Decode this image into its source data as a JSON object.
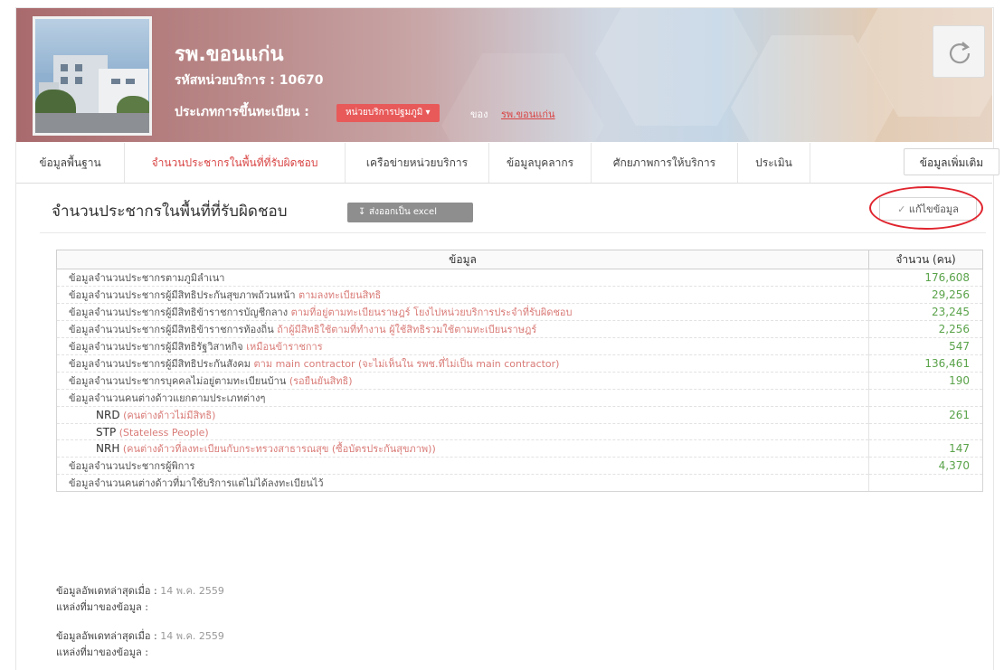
{
  "header": {
    "hospital_name": "รพ.ขอนแก่น",
    "service_code": "รหัสหน่วยบริการ : 10670",
    "registration_type_label": "ประเภทการขึ้นทะเบียน :",
    "registration_type_value": "หน่วยบริการปฐมภูมิ",
    "of_label": "ของ",
    "parent_link": "รพ.ขอนแก่น"
  },
  "tabs": [
    "ข้อมูลพื้นฐาน",
    "จำนวนประชากรในพื้นที่ที่รับผิดชอบ",
    "เครือข่ายหน่วยบริการ",
    "ข้อมูลบุคลากร",
    "ศักยภาพการให้บริการ",
    "ประเมิน"
  ],
  "more_button": "ข้อมูลเพิ่มเติม",
  "section": {
    "title": "จำนวนประชากรในพื้นที่ที่รับผิดชอบ",
    "export_button": "ส่งออกเป็น excel",
    "edit_button": "แก้ไขข้อมูล"
  },
  "table": {
    "col_header_info": "ข้อมูล",
    "col_header_count": "จำนวน (คน)",
    "rows": [
      {
        "label": "ข้อมูลจำนวนประชากรตามภูมิลำเนา",
        "note": "",
        "value": "176,608"
      },
      {
        "label": "ข้อมูลจำนวนประชากรผู้มีสิทธิประกันสุขภาพถ้วนหน้า",
        "note": "ตามลงทะเบียนสิทธิ",
        "value": "29,256"
      },
      {
        "label": "ข้อมูลจำนวนประชากรผู้มีสิทธิข้าราชการบัญชีกลาง",
        "note": "ตามที่อยู่ตามทะเบียนราษฎร์ โยงไปหน่วยบริการประจำที่รับผิดชอบ",
        "value": "23,245"
      },
      {
        "label": "ข้อมูลจำนวนประชากรผู้มีสิทธิข้าราชการท้องถิ่น",
        "note": "ถ้าผู้มีสิทธิใช้ตามที่ทำงาน ผู้ใช้สิทธิรวมใช้ตามทะเบียนราษฎร์",
        "value": "2,256"
      },
      {
        "label": "ข้อมูลจำนวนประชากรผู้มีสิทธิรัฐวิสาหกิจ",
        "note": "เหมือนข้าราชการ",
        "value": "547"
      },
      {
        "label": "ข้อมูลจำนวนประชากรผู้มีสิทธิประกันสังคม",
        "note": "ตาม main contractor (จะไม่เห็นใน รพช.ที่ไม่เป็น main contractor)",
        "value": "136,461"
      },
      {
        "label": "ข้อมูลจำนวนประชากรบุคคลไม่อยู่ตามทะเบียนบ้าน",
        "note": "(รอยืนยันสิทธิ)",
        "value": "190"
      },
      {
        "label": "ข้อมูลจำนวนคนต่างด้าวแยกตามประเภทต่างๆ",
        "note": "",
        "value": ""
      },
      {
        "label": "NRD",
        "note": "(คนต่างด้าวไม่มีสิทธิ)",
        "value": "261",
        "sub": true
      },
      {
        "label": "STP",
        "note": "(Stateless People)",
        "value": "",
        "sub": true
      },
      {
        "label": "NRH",
        "note": "(คนต่างด้าวที่ลงทะเบียนกับกระทรวงสาธารณสุข (ซื้อบัตรประกันสุขภาพ))",
        "value": "147",
        "sub": true
      },
      {
        "label": "ข้อมูลจำนวนประชากรผู้พิการ",
        "note": "",
        "value": "4,370"
      },
      {
        "label": "ข้อมูลจำนวนคนต่างด้าวที่มาใช้บริการแต่ไม่ได้ลงทะเบียนไว้",
        "note": "",
        "value": ""
      }
    ]
  },
  "footer": [
    {
      "updated_label": "ข้อมูลอัพเดทล่าสุดเมื่อ :",
      "updated_value": "14 พ.ค. 2559",
      "source_label": "แหล่งที่มาของข้อมูล :"
    },
    {
      "updated_label": "ข้อมูลอัพเดทล่าสุดเมื่อ :",
      "updated_value": "14 พ.ค. 2559",
      "source_label": "แหล่งที่มาของข้อมูล :"
    }
  ],
  "colors": {
    "accent_red": "#d94545",
    "value_green": "#5aa34a",
    "note_pink": "#d97c78",
    "highlight_ring": "#e0242e"
  },
  "icons": {
    "refresh": "refresh-icon",
    "export": "download-icon",
    "edit": "wrench-icon",
    "dropdown": "caret-down-icon"
  }
}
